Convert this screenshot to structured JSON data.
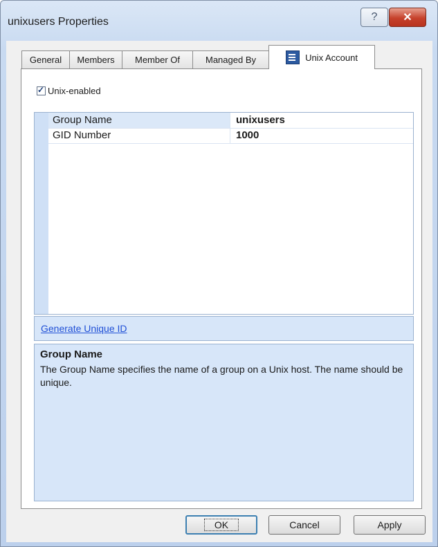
{
  "window": {
    "title": "unixusers Properties",
    "help_glyph": "?",
    "close_glyph": "✕"
  },
  "tabs": [
    {
      "label": "General"
    },
    {
      "label": "Members"
    },
    {
      "label": "Member Of"
    },
    {
      "label": "Managed By"
    },
    {
      "label": "Unix Account",
      "active": true,
      "icon": "unix-account-icon"
    }
  ],
  "unix_enabled": {
    "label": "Unix-enabled",
    "checked": true
  },
  "properties": [
    {
      "name": "Group Name",
      "value": "unixusers"
    },
    {
      "name": "GID Number",
      "value": "1000"
    }
  ],
  "command": {
    "label": "Generate Unique ID"
  },
  "description": {
    "title": "Group Name",
    "text": "The Group Name specifies the name of a group on a Unix host.  The name should be unique."
  },
  "buttons": {
    "ok": "OK",
    "cancel": "Cancel",
    "apply": "Apply"
  }
}
